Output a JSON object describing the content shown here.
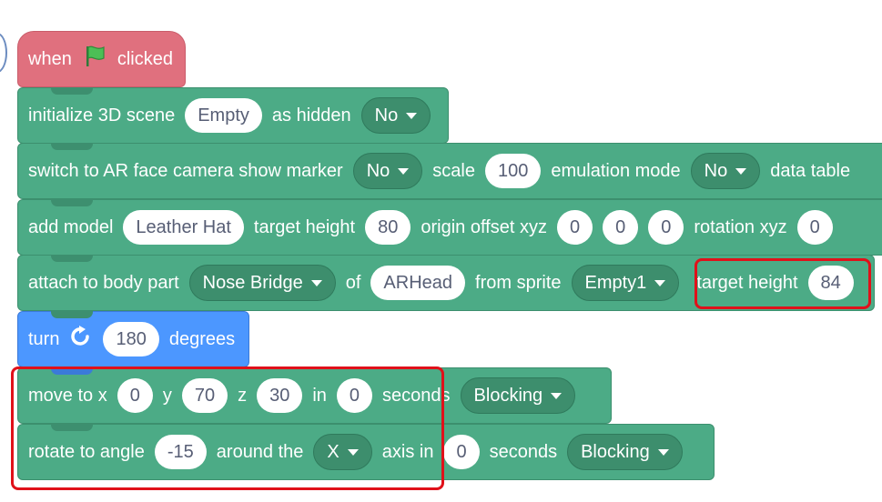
{
  "hat": {
    "when": "when",
    "clicked": "clicked",
    "flag_icon": "green-flag"
  },
  "init": {
    "label": "initialize 3D scene",
    "scene": "Empty",
    "as_hidden": "as hidden",
    "hidden_value": "No"
  },
  "switch_ar": {
    "label": "switch to AR face camera show marker",
    "marker": "No",
    "scale_label": "scale",
    "scale": "100",
    "emulation_label": "emulation mode",
    "emulation": "No",
    "data_table": "data table"
  },
  "add_model": {
    "label": "add model",
    "model": "Leather Hat",
    "target_height_label": "target height",
    "target_height": "80",
    "origin_label": "origin offset xyz",
    "ox": "0",
    "oy": "0",
    "oz": "0",
    "rotation_label": "rotation xyz",
    "rx": "0"
  },
  "attach": {
    "label": "attach to body part",
    "part": "Nose Bridge",
    "of": "of",
    "target": "ARHead",
    "from_sprite": "from sprite",
    "sprite": "Empty1",
    "target_height_label": "target height",
    "target_height": "84"
  },
  "turn": {
    "label": "turn",
    "icon": "rotate-right",
    "value": "180",
    "degrees": "degrees"
  },
  "move": {
    "label": "move to x",
    "x": "0",
    "y_label": "y",
    "y": "70",
    "z_label": "z",
    "z": "30",
    "in": "in",
    "secs": "0",
    "seconds": "seconds",
    "mode": "Blocking"
  },
  "rotate": {
    "label": "rotate to angle",
    "angle": "-15",
    "around": "around the",
    "axis": "X",
    "axis_in": "axis in",
    "secs": "0",
    "seconds": "seconds",
    "mode": "Blocking"
  },
  "colors": {
    "hat": "#e0707e",
    "green": "#4cab86",
    "blue": "#4c97ff",
    "highlight": "#e0111a"
  }
}
